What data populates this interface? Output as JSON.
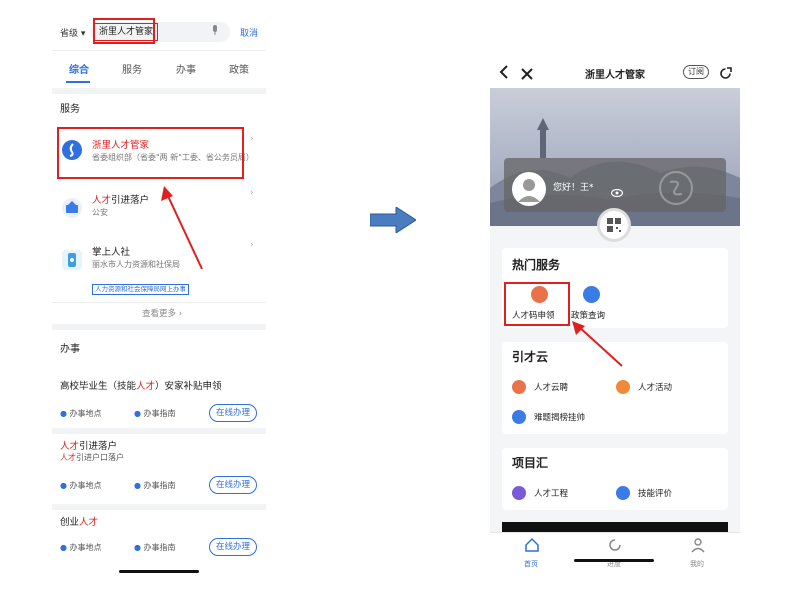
{
  "left_phone": {
    "search": {
      "region": "省级",
      "region_caret": "▾",
      "query": "浙里人才管家",
      "mic_icon": "microphone-icon",
      "cancel": "取消"
    },
    "tabs": [
      "综合",
      "服务",
      "办事",
      "政策"
    ],
    "services": {
      "title": "服务",
      "items": [
        {
          "title": "浙里人才管家",
          "subtitle": "省委组织部（省委\"两 新\"工委、省公务员局）",
          "icon": "app-logo-icon"
        },
        {
          "title_highlight": "人才",
          "title_rest": "引进落户",
          "subtitle": "公安",
          "icon": "id-card-icon"
        },
        {
          "title": "掌上人社",
          "subtitle": "丽水市人力资源和社保局",
          "tag": "人力资源和社会保障局网上办事",
          "icon": "phone-icon"
        }
      ],
      "more": "查看更多 ›"
    },
    "affairs": {
      "title": "办事",
      "items": [
        {
          "title_pre": "高校毕业生（技能",
          "title_highlight": "人才",
          "title_post": "）安家补贴申领",
          "sub": ""
        },
        {
          "title_pre": "",
          "title_highlight": "人才",
          "title_post": "引进落户",
          "sub_highlight": "人才",
          "sub_rest": "引进户口落户"
        },
        {
          "title_pre": "创业",
          "title_highlight": "人才",
          "title_post": "",
          "sub": ""
        }
      ],
      "location_label": "办事地点",
      "guide_label": "办事指南",
      "button_label": "在线办理"
    },
    "arrow_color": "#e02020"
  },
  "middle_arrow_color": "#4a7cc0",
  "right_phone": {
    "nav": {
      "back_icon": "back-icon",
      "close_icon": "close-icon",
      "title": "浙里人才管家",
      "subscribe": "订阅",
      "share_icon": "share-icon"
    },
    "profile": {
      "greeting": "您好！王*",
      "eye_icon": "eye-icon"
    },
    "hot_services": {
      "title": "热门服务",
      "items": [
        {
          "label": "人才码申领",
          "color": "#e8734a",
          "icon": "talent-code-icon"
        },
        {
          "label": "政策查询",
          "color": "#3b7be8",
          "icon": "policy-icon"
        }
      ]
    },
    "talent_cloud": {
      "title": "引才云",
      "items": [
        {
          "label": "人才云聘",
          "color": "#e8734a",
          "icon": "recruit-icon"
        },
        {
          "label": "人才活动",
          "color": "#f08a3a",
          "icon": "activity-icon"
        },
        {
          "label": "难题揭榜挂帅",
          "color": "#3b7be8",
          "icon": "challenge-icon"
        }
      ]
    },
    "projects": {
      "title": "项目汇",
      "items": [
        {
          "label": "人才工程",
          "color": "#7a5bd6",
          "icon": "project-icon"
        },
        {
          "label": "技能评价",
          "color": "#3b7be8",
          "icon": "skill-icon"
        }
      ]
    },
    "bottom_tabs": [
      {
        "label": "首页",
        "icon": "home-icon",
        "active": true
      },
      {
        "label": "进度",
        "icon": "progress-icon",
        "active": false
      },
      {
        "label": "我的",
        "icon": "user-icon",
        "active": false
      }
    ]
  },
  "accent": "#2f6fe0",
  "highlight_red": "#e02020"
}
